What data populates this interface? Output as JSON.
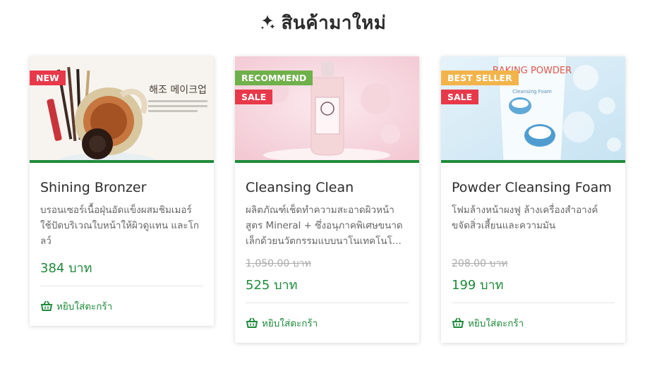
{
  "section": {
    "title": "สินค้ามาใหม่",
    "icon": "sparkle-icon"
  },
  "cards": [
    {
      "name": "Shining Bronzer",
      "desc": "บรอนเซอร์เนื้อฝุ่นอัดแข็งผสมชิมเมอร์ ใช้ปัดบริเวณใบหน้าให้ผิวดูแทน และโกลว์",
      "old_price": "",
      "price": "384 บาท",
      "badges": [
        "NEW"
      ],
      "image_caption": "해조 메이크업",
      "cart_label": "หยิบใส่ตะกร้า"
    },
    {
      "name": "Cleansing Clean",
      "desc": "ผลิตภัณฑ์เช็ดทำความสะอาดผิวหน้าสูตร Mineral + ซึ่งอนุภาคพิเศษขนาดเล็กด้วยนวัตกรรมแบบนาโนเทคโนโ...",
      "old_price": "1,050.00 บาท",
      "price": "525 บาท",
      "badges": [
        "RECOMMEND",
        "SALE"
      ],
      "cart_label": "หยิบใส่ตะกร้า"
    },
    {
      "name": "Powder Cleansing Foam",
      "desc": "โฟมล้างหน้าผงฟู ล้างเครื่องสำอางค์ ขจัดสิ่วเสี้ยนและความมัน",
      "old_price": "208.00 บาท",
      "price": "199 บาท",
      "badges": [
        "BEST SELLER",
        "SALE"
      ],
      "image_caption": "BAKING POWDER",
      "image_subcaption": "Cleansing Foam",
      "cart_label": "หยิบใส่ตะกร้า"
    }
  ],
  "colors": {
    "accent": "#1f8a3a",
    "sale": "#e8394a",
    "recommend": "#6fb04a",
    "bestseller": "#f2b44a"
  }
}
